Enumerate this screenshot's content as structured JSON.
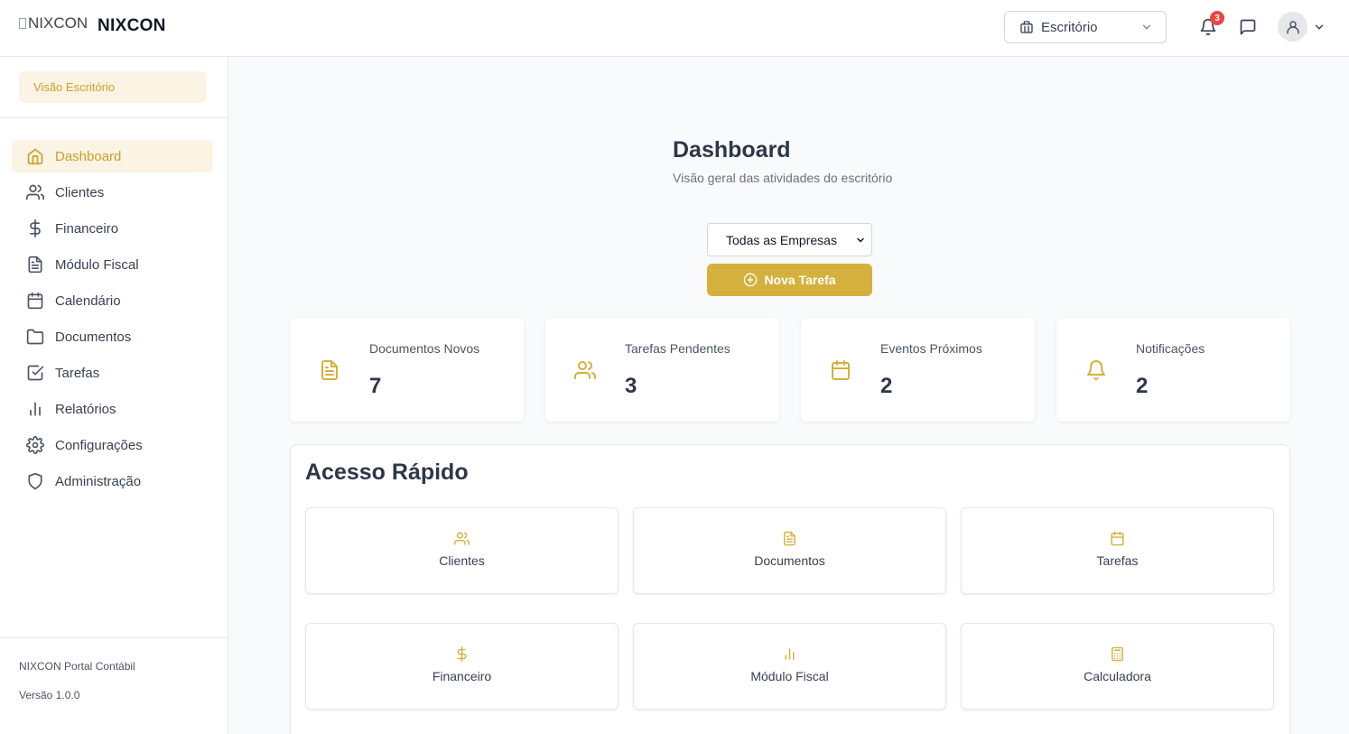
{
  "header": {
    "logo_alt": "NIXCON",
    "brand": "NIXCON",
    "office_selector": "Escritório",
    "notification_count": "3"
  },
  "sidebar": {
    "view_chip": "Visão Escritório",
    "items": [
      {
        "label": "Dashboard",
        "icon": "home-icon",
        "active": true
      },
      {
        "label": "Clientes",
        "icon": "users-icon"
      },
      {
        "label": "Financeiro",
        "icon": "dollar-icon"
      },
      {
        "label": "Módulo Fiscal",
        "icon": "file-text-icon"
      },
      {
        "label": "Calendário",
        "icon": "calendar-icon"
      },
      {
        "label": "Documentos",
        "icon": "folder-icon"
      },
      {
        "label": "Tarefas",
        "icon": "check-square-icon"
      },
      {
        "label": "Relatórios",
        "icon": "bar-chart-icon"
      },
      {
        "label": "Configurações",
        "icon": "gear-icon"
      },
      {
        "label": "Administração",
        "icon": "shield-icon"
      }
    ],
    "footer_title": "NIXCON Portal Contábil",
    "footer_version": "Versão 1.0.0"
  },
  "main": {
    "title": "Dashboard",
    "subtitle": "Visão geral das atividades do escritório",
    "company_filter": "Todas as Empresas",
    "new_task_label": "Nova Tarefa",
    "stats": [
      {
        "label": "Documentos Novos",
        "value": "7",
        "icon": "file-text-icon"
      },
      {
        "label": "Tarefas Pendentes",
        "value": "3",
        "icon": "users-icon"
      },
      {
        "label": "Eventos Próximos",
        "value": "2",
        "icon": "calendar-icon"
      },
      {
        "label": "Notificações",
        "value": "2",
        "icon": "bell-icon"
      }
    ],
    "quick_access": {
      "title": "Acesso Rápido",
      "items": [
        {
          "label": "Clientes",
          "icon": "users-icon"
        },
        {
          "label": "Documentos",
          "icon": "file-text-icon"
        },
        {
          "label": "Tarefas",
          "icon": "calendar-icon"
        },
        {
          "label": "Financeiro",
          "icon": "dollar-icon"
        },
        {
          "label": "Módulo Fiscal",
          "icon": "bar-chart-icon"
        },
        {
          "label": "Calculadora",
          "icon": "calculator-icon"
        }
      ]
    }
  },
  "colors": {
    "accent": "#d4b13c",
    "accent_text": "#c9a227",
    "accent_bg": "#fbf3e4",
    "badge": "#ef4444"
  }
}
